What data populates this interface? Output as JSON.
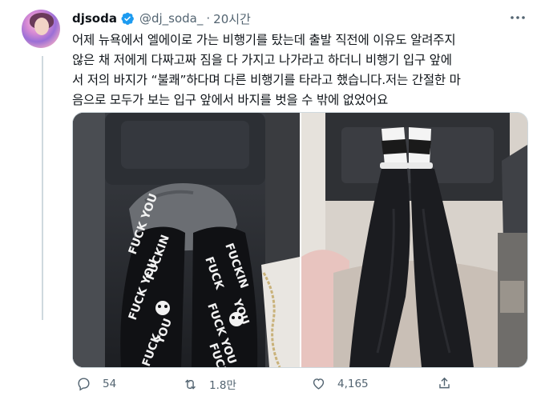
{
  "tweet": {
    "display_name": "djsoda",
    "handle": "@dj_soda_",
    "separator": "·",
    "time": "20시간",
    "text_lines": [
      "어제 뉴욕에서 엘에이로 가는 비행기를 탔는데 출발 직전에 이유도 알려주지",
      "않은 채 저에게 다짜고짜 짐을 다 가지고 나가라고 하더니 비행기 입구 앞에",
      "서 저의 바지가 “불쾌”하다며 다른 비행기를 타라고 했습니다.저는 간절한 마",
      "음으로 모두가 보는 입구 앞에서 바지를 벗을 수 밖에 없었어요"
    ],
    "pants_text": [
      "FUCK YOU",
      "FUCKIN",
      "YOU",
      "FUCK"
    ]
  },
  "actions": {
    "replies": "54",
    "retweets": "1.8만",
    "likes": "4,165"
  },
  "icons": {
    "verified": "verified-badge-icon",
    "more": "more-options-icon",
    "reply": "reply-icon",
    "retweet": "retweet-icon",
    "like": "heart-icon",
    "share": "share-icon"
  },
  "colors": {
    "accent": "#1d9bf0",
    "secondary_text": "#536471",
    "border": "#cfd9de"
  }
}
